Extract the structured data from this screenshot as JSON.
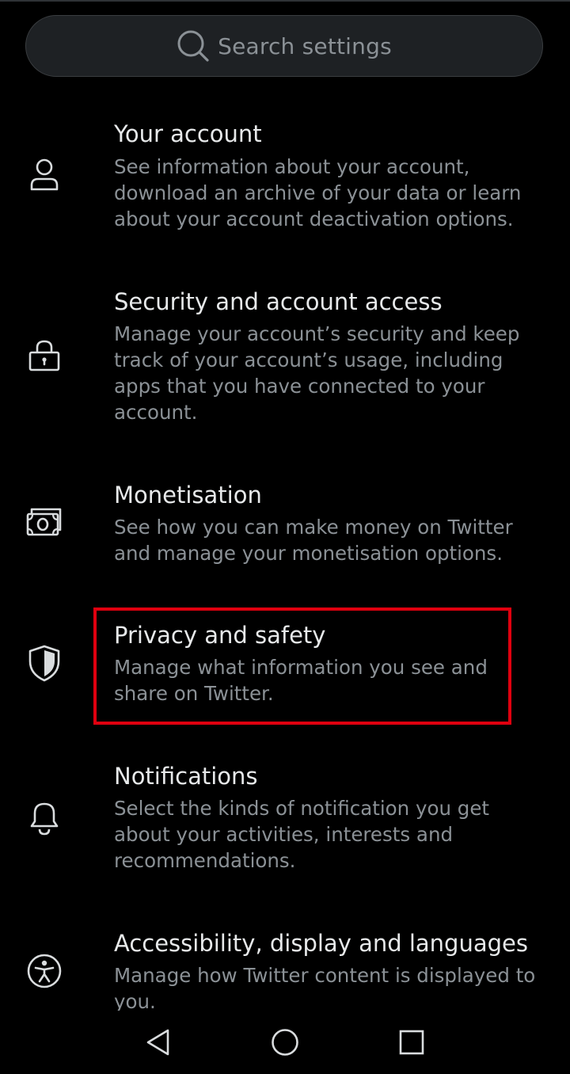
{
  "search": {
    "placeholder": "Search settings",
    "icon": "search-icon"
  },
  "settings": [
    {
      "id": "your-account",
      "icon": "person-icon",
      "title": "Your account",
      "description": "See information about your account, download an archive of your data or learn about your account deactivation options."
    },
    {
      "id": "security",
      "icon": "lock-icon",
      "title": "Security and account access",
      "description": "Manage your account’s security and keep track of your account’s usage, including apps that you have connected to your account."
    },
    {
      "id": "monetisation",
      "icon": "money-icon",
      "title": "Monetisation",
      "description": "See how you can make money on Twitter and manage your monetisation options."
    },
    {
      "id": "privacy",
      "icon": "shield-icon",
      "title": "Privacy and safety",
      "description": "Manage what information you see and share on Twitter."
    },
    {
      "id": "notifications",
      "icon": "bell-icon",
      "title": "Notifications",
      "description": "Select the kinds of notification you get about your activities, interests and recommendations."
    },
    {
      "id": "accessibility",
      "icon": "accessibility-icon",
      "title": "Accessibility, display and languages",
      "description": "Manage how Twitter content is displayed to you."
    }
  ],
  "nav": {
    "back_icon": "back-triangle-icon",
    "home_icon": "home-circle-icon",
    "recents_icon": "recents-square-icon"
  },
  "colors": {
    "background": "#000000",
    "primary_text": "#e7e9ea",
    "secondary_text": "#8b9196",
    "search_bg": "#1e2124",
    "highlight": "#e0000f"
  }
}
